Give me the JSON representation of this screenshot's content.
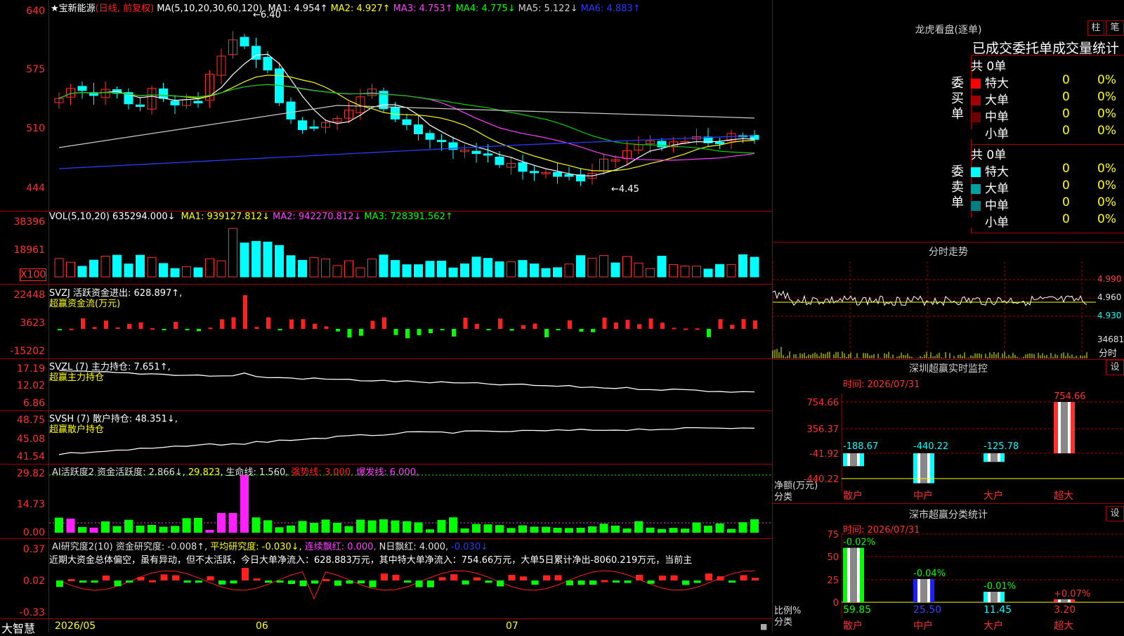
{
  "stock": {
    "star": "★",
    "name": "宝新能源",
    "mode": "(日线, 前复权)"
  },
  "ma_header": {
    "label": "MA(5,10,20,30,60,120)",
    "items": [
      {
        "t": "MA1: 4.954↑",
        "c": "#ffffff"
      },
      {
        "t": "MA2: 4.927↑",
        "c": "#ffff00"
      },
      {
        "t": "MA3: 4.753↑",
        "c": "#ff40ff"
      },
      {
        "t": "MA4: 4.775↓",
        "c": "#00ff00"
      },
      {
        "t": "MA5: 5.122↓",
        "c": "#d0d0d0"
      },
      {
        "t": "MA6: 4.883↑",
        "c": "#2a3aff"
      }
    ]
  },
  "price_axis": [
    "640",
    "575",
    "510",
    "444"
  ],
  "price_high": "6.40",
  "price_low": "4.45",
  "vol_header": {
    "label": "VOL(5,10,20)",
    "value": "635294.000↓",
    "items": [
      {
        "t": "MA1: 939127.812↓",
        "c": "#ffff00"
      },
      {
        "t": "MA2: 942270.812↓",
        "c": "#ff40ff"
      },
      {
        "t": "MA3: 728391.562↑",
        "c": "#00ff00"
      }
    ]
  },
  "vol_axis": [
    "38396",
    "18961",
    "X100"
  ],
  "flow_header": {
    "label": "SVZJ  活跃资金进出: 628.897↑,",
    "sub": "超赢资金流(万元)"
  },
  "flow_axis": [
    "22448",
    "3623",
    "-15202"
  ],
  "svzl_header": {
    "label": "SVZL (7) 主力持仓: 7.651↑,",
    "sub": "超赢主力持仓"
  },
  "svzl_axis": [
    "17.19",
    "12.02",
    "6.86"
  ],
  "svsh_header": {
    "label": "SVSH (7) 散户持仓: 48.351↓,",
    "sub": "超赢散户持仓"
  },
  "svsh_axis": [
    "48.75",
    "45.08",
    "41.54"
  ],
  "ai2_header": {
    "items": [
      {
        "t": "AI活跃度2 资金活跃度: 2.866↓,",
        "c": "#e0e0e0"
      },
      {
        "t": "29.823,",
        "c": "#ffff00"
      },
      {
        "t": "生命线: 1.560,",
        "c": "#e0e0e0"
      },
      {
        "t": "强势线: 3.000,",
        "c": "#ff2020"
      },
      {
        "t": "爆发线: 6.000,",
        "c": "#ff40ff"
      }
    ]
  },
  "ai2_axis": [
    "29.82",
    "14.73",
    "0.00"
  ],
  "ai_res_header": {
    "items": [
      {
        "t": "AI研究度2(10) 资金研究度: -0.008↑,",
        "c": "#e0e0e0"
      },
      {
        "t": "平均研究度: -0.030↓,",
        "c": "#ffff00"
      },
      {
        "t": "连续飘红: 0.000,",
        "c": "#ff40ff"
      },
      {
        "t": "N日飘红: 4.000,",
        "c": "#e0e0e0"
      },
      {
        "t": "-0.030↓",
        "c": "#2a3aff"
      }
    ]
  },
  "ai_res_text": "近期大资金总体偏空，虽有异动，但不太活跃，今日大单净流入：628.883万元，其中特大单净流入：754.66万元，大单5日累计净出-8060.219万元，当前主",
  "ai_res_axis": [
    "0.37",
    "0.02",
    "-0.33"
  ],
  "bottom": {
    "logo": "大智慧",
    "dates": [
      "2026/05",
      "06",
      "07"
    ]
  },
  "dragon": {
    "title": "龙虎看盘(逐单)",
    "btn1": "柱",
    "btn2": "笔",
    "subtitle": "已成交委托单成交量统计",
    "buy": {
      "side": "委买单",
      "total": "共 0单",
      "rows": [
        {
          "name": "特大",
          "v": "0",
          "p": "0%",
          "c": "#ff0000"
        },
        {
          "name": "大单",
          "v": "0",
          "p": "0%",
          "c": "#a00000"
        },
        {
          "name": "中单",
          "v": "0",
          "p": "0%",
          "c": "#700000"
        },
        {
          "name": "小单",
          "v": "0",
          "p": "0%",
          "c": "#000000"
        }
      ]
    },
    "sell": {
      "side": "委卖单",
      "total": "共 0单",
      "rows": [
        {
          "name": "特大",
          "v": "0",
          "p": "0%",
          "c": "#00ffff"
        },
        {
          "name": "大单",
          "v": "0",
          "p": "0%",
          "c": "#00a0a0"
        },
        {
          "name": "中单",
          "v": "0",
          "p": "0%",
          "c": "#008080"
        },
        {
          "name": "小单",
          "v": "0",
          "p": "0%",
          "c": "#000000"
        }
      ]
    }
  },
  "intraday": {
    "title": "分时走势",
    "prices": [
      "4.990",
      "4.960",
      "4.930"
    ],
    "vol": "34681",
    "vol_label": "分时"
  },
  "sz_monitor": {
    "title": "深圳超赢实时监控",
    "btn": "设",
    "time": "时间: 2026/07/31",
    "axis": [
      "754.66",
      "356.37",
      "-41.92",
      "-440.22"
    ],
    "unit": "净额(万元)",
    "cls": "分类",
    "cats": [
      "散户",
      "中户",
      "大户",
      "超大"
    ],
    "vals": [
      "-188.67",
      "-440.22",
      "-125.78",
      "754.66"
    ]
  },
  "sz_class": {
    "title": "深市超赢分类统计",
    "btn": "设",
    "time": "时间: 2026/07/31",
    "axis": [
      "75",
      "50",
      "25",
      "0"
    ],
    "unit": "比例%",
    "cls": "分类",
    "cats": [
      "散户",
      "中户",
      "大户",
      "超大"
    ],
    "vals": [
      "59.85",
      "25.50",
      "11.45",
      "3.20"
    ],
    "pcts": [
      "-0.02%",
      "-0.04%",
      "-0.01%",
      "+0.07%"
    ]
  }
}
